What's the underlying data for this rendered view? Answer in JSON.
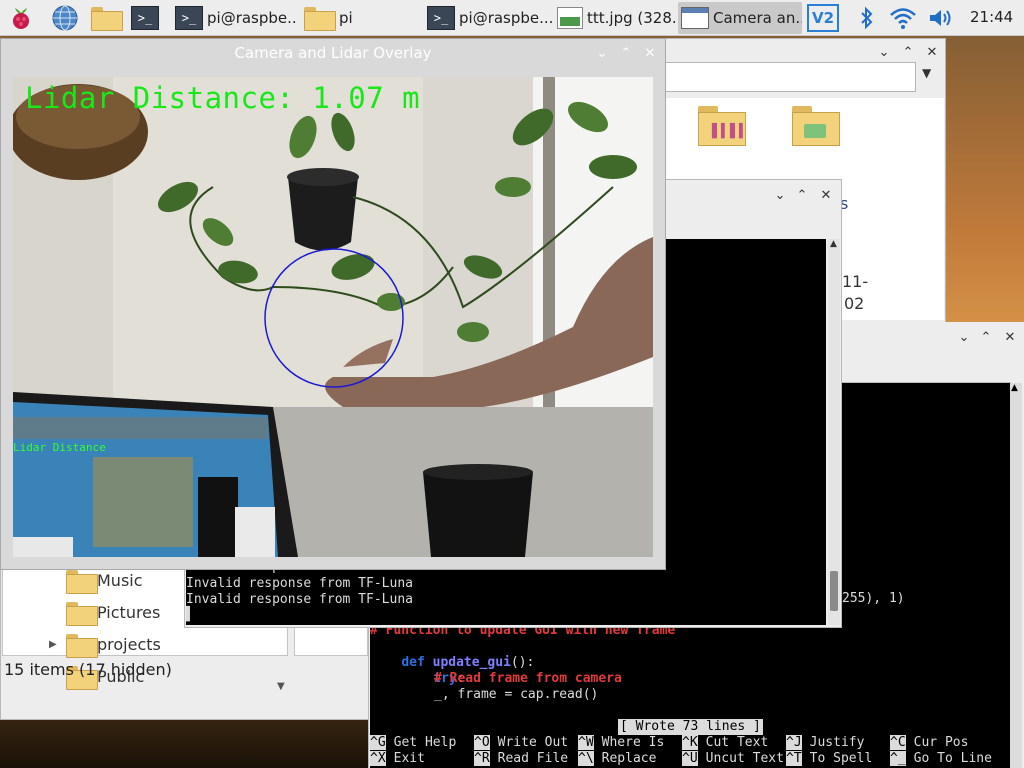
{
  "taskbar": {
    "tasks": [
      {
        "label": ""
      },
      {
        "label": "pi@raspbe..."
      },
      {
        "label": "pi"
      },
      {
        "label": "pi@raspbe..."
      },
      {
        "label": "ttt.jpg (328..."
      },
      {
        "label": "Camera an..."
      }
    ],
    "clock": "21:44"
  },
  "camera_window": {
    "title": "Camera and Lidar Overlay",
    "overlay_text": "Lidar Distance: 1.07 m",
    "inset_text": "Lidar Distance"
  },
  "file_manager": {
    "folders": [
      {
        "label": "Music"
      },
      {
        "label": "Pictures"
      },
      {
        "label": "projects"
      },
      {
        "label": "Public"
      }
    ],
    "status": "15 items (17 hidden)",
    "partial_labels": [
      "s",
      "11-",
      "02"
    ]
  },
  "terminal_mid": {
    "lines": [
      "Invalid response from TF-Luna",
      "Invalid response from TF-Luna",
      "Invalid response from TF-Luna"
    ],
    "cursor": "▌"
  },
  "nano": {
    "partial_line": "255), 1)",
    "code": [
      {
        "text": "# Function to update GUI with new frame",
        "kind": "comment"
      },
      {
        "kw": "def",
        "name": "update_gui",
        "rest": "():"
      },
      {
        "kw": "try",
        "rest": ":"
      },
      {
        "text": "# Read frame from camera",
        "kind": "comment"
      },
      {
        "text": "_, frame = cap.read()",
        "kind": "plain"
      }
    ],
    "status_msg": "[ Wrote 73 lines ]",
    "shortcuts_row1": [
      {
        "key": "^G",
        "label": "Get Help"
      },
      {
        "key": "^O",
        "label": "Write Out"
      },
      {
        "key": "^W",
        "label": "Where Is"
      },
      {
        "key": "^K",
        "label": "Cut Text"
      },
      {
        "key": "^J",
        "label": "Justify"
      },
      {
        "key": "^C",
        "label": "Cur Pos"
      }
    ],
    "shortcuts_row2": [
      {
        "key": "^X",
        "label": "Exit"
      },
      {
        "key": "^R",
        "label": "Read File"
      },
      {
        "key": "^\\",
        "label": "Replace"
      },
      {
        "key": "^U",
        "label": "Uncut Text"
      },
      {
        "key": "^T",
        "label": "To Spell"
      },
      {
        "key": "^_",
        "label": "Go To Line"
      }
    ]
  },
  "colors": {
    "terminal_bg": "#000000",
    "comment": "#e03a3a",
    "keyword": "#2f6fe0",
    "lidar_text": "#18e818",
    "circle": "#1a1ad0"
  }
}
